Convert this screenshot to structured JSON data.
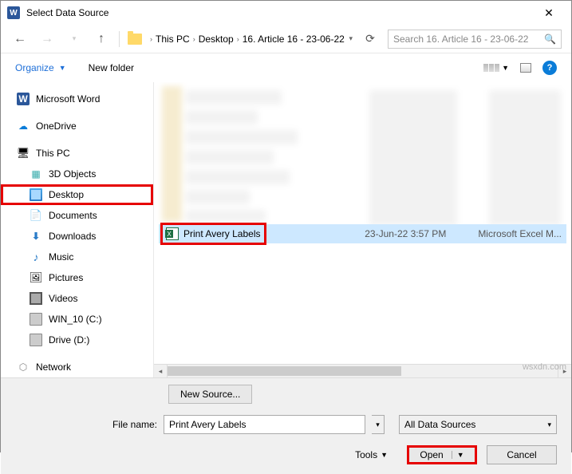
{
  "window": {
    "title": "Select Data Source"
  },
  "nav": {
    "breadcrumb": [
      "This PC",
      "Desktop",
      "16. Article 16 - 23-06-22"
    ],
    "search_placeholder": "Search 16. Article 16 - 23-06-22"
  },
  "toolbar": {
    "organize": "Organize",
    "new_folder": "New folder"
  },
  "sidebar": {
    "items": [
      {
        "label": "Microsoft Word"
      },
      {
        "label": "OneDrive"
      },
      {
        "label": "This PC"
      },
      {
        "label": "3D Objects"
      },
      {
        "label": "Desktop"
      },
      {
        "label": "Documents"
      },
      {
        "label": "Downloads"
      },
      {
        "label": "Music"
      },
      {
        "label": "Pictures"
      },
      {
        "label": "Videos"
      },
      {
        "label": "WIN_10 (C:)"
      },
      {
        "label": "Drive (D:)"
      },
      {
        "label": "Network"
      }
    ]
  },
  "file": {
    "name": "Print Avery Labels",
    "date": "23-Jun-22 3:57 PM",
    "type": "Microsoft Excel M..."
  },
  "footer": {
    "new_source": "New Source...",
    "file_name_label": "File name:",
    "file_name_value": "Print Avery Labels",
    "filter": "All Data Sources",
    "tools": "Tools",
    "open": "Open",
    "cancel": "Cancel"
  },
  "watermark": "wsxdn.com"
}
